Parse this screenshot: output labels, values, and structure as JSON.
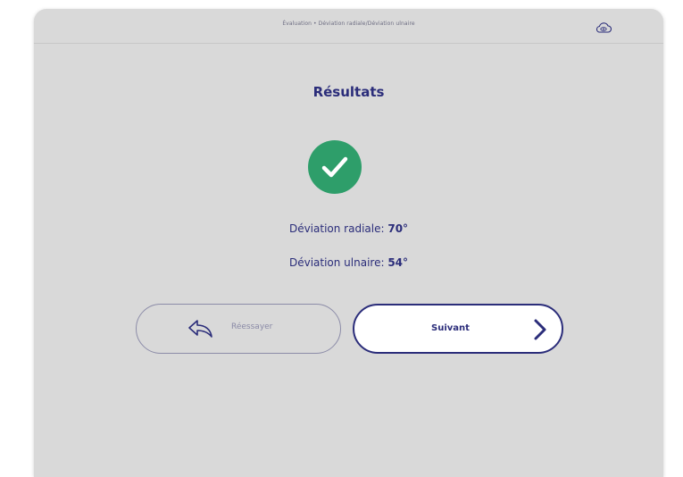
{
  "header": {
    "breadcrumb": "Évaluation • Déviation radiale/Déviation ulnaire",
    "icon": "cloud-eye-icon"
  },
  "results": {
    "title": "Résultats",
    "status_icon": "check-circle-icon",
    "status_color": "#2e9e6a",
    "radial_label": "Déviation radiale: ",
    "radial_value": "70°",
    "ulnar_label": "Déviation ulnaire: ",
    "ulnar_value": "54°"
  },
  "actions": {
    "retry_label": "Réessayer",
    "retry_icon": "undo-arrow-icon",
    "next_label": "Suivant",
    "next_icon": "chevron-right-icon"
  },
  "colors": {
    "primary": "#2b2d7a",
    "background": "#d9d9d9",
    "success": "#2e9e6a"
  }
}
